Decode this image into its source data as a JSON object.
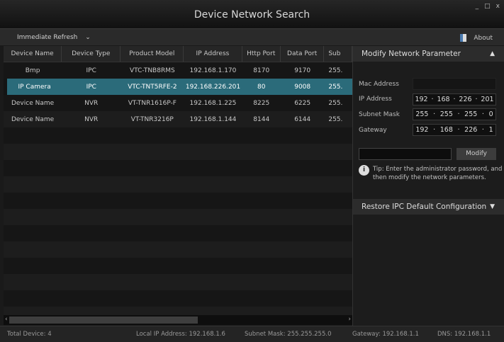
{
  "window": {
    "title": "Device Network Search",
    "minimize": "_",
    "maximize": "□",
    "close": "x"
  },
  "toolbar": {
    "refresh": "Immediate Refresh",
    "refresh_chevron": "⌄",
    "about": "About"
  },
  "table": {
    "headers": [
      "Device Name",
      "Device Type",
      "Product Model",
      "IP Address",
      "Http Port",
      "Data Port",
      "Sub"
    ],
    "rows": [
      [
        "Bmp",
        "IPC",
        "VTC-TNB8RMS",
        "192.168.1.170",
        "8170",
        "9170",
        "255."
      ],
      [
        "IP Camera",
        "IPC",
        "VTC-TNT5RFE-2",
        "192.168.226.201",
        "80",
        "9008",
        "255."
      ],
      [
        "Device Name",
        "NVR",
        "VT-TNR1616P-F",
        "192.168.1.225",
        "8225",
        "6225",
        "255."
      ],
      [
        "Device Name",
        "NVR",
        "VT-TNR3216P",
        "192.168.1.144",
        "8144",
        "6144",
        "255."
      ]
    ],
    "selected_row": 1
  },
  "panel": {
    "modify_title": "Modify Network Parameter",
    "mac_label": "Mac Address",
    "mac_value": "",
    "ip_label": "IP Address",
    "ip": [
      "192",
      "168",
      "226",
      "201"
    ],
    "mask_label": "Subnet Mask",
    "mask": [
      "255",
      "255",
      "255",
      "0"
    ],
    "gw_label": "Gateway",
    "gw": [
      "192",
      "168",
      "226",
      "1"
    ],
    "password_value": "",
    "modify_button": "Modify",
    "tip": "Tip: Enter the administrator password, and then modify the network parameters.",
    "restore_title": "Restore IPC Default Configuration"
  },
  "status": {
    "total": "Total Device: 4",
    "local_ip": "Local IP Address: 192.168.1.6",
    "mask": "Subnet Mask: 255.255.255.0",
    "gateway": "Gateway: 192.168.1.1",
    "dns": "DNS: 192.168.1.1"
  }
}
